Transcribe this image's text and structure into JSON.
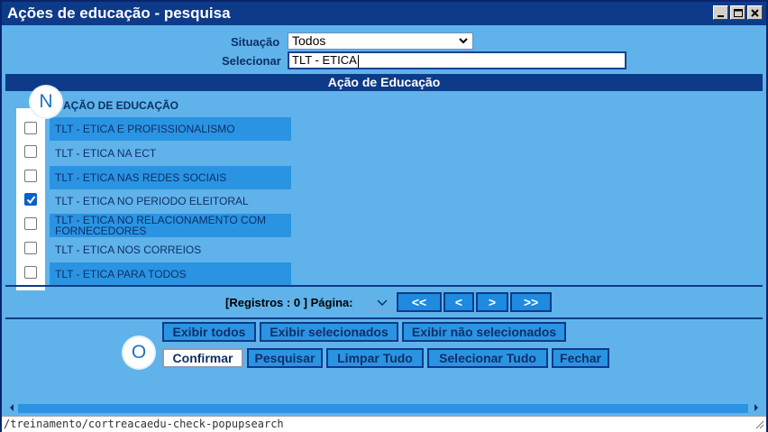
{
  "window": {
    "title": "Ações de educação - pesquisa",
    "controls": [
      "minimize-icon",
      "maximize-icon",
      "close-icon"
    ]
  },
  "filter": {
    "situacao_label": "Situação",
    "situacao_value": "Todos",
    "selecionar_label": "Selecionar",
    "selecionar_value": "TLT - ETICA"
  },
  "section_header": "Ação de Educação",
  "list": {
    "column_header": "AÇÃO DE EDUCAÇÃO",
    "rows": [
      {
        "label": "TLT - ETICA E PROFISSIONALISMO",
        "checked": false
      },
      {
        "label": "TLT - ETICA NA ECT",
        "checked": false
      },
      {
        "label": "TLT - ETICA NAS REDES SOCIAIS",
        "checked": false
      },
      {
        "label": "TLT - ETICA NO PERIODO ELEITORAL",
        "checked": true
      },
      {
        "label": "TLT - ETICA NO RELACIONAMENTO COM FORNECEDORES",
        "checked": false
      },
      {
        "label": "TLT - ETICA NOS CORREIOS",
        "checked": false
      },
      {
        "label": "TLT - ETICA PARA TODOS",
        "checked": false
      }
    ]
  },
  "badges": {
    "n": "N",
    "o": "O"
  },
  "pager": {
    "info": "[Registros : 0 ] Página:",
    "first": "<<",
    "prev": "<",
    "next": ">",
    "last": ">>"
  },
  "actions_row1": {
    "exibir_todos": "Exibir todos",
    "exibir_selecionados": "Exibir selecionados",
    "exibir_nao_selecionados": "Exibir não selecionados"
  },
  "actions_row2": {
    "confirmar": "Confirmar",
    "pesquisar": "Pesquisar",
    "limpar_tudo": "Limpar Tudo",
    "selecionar_tudo": "Selecionar Tudo",
    "fechar": "Fechar"
  },
  "status": {
    "url": "/treinamento/cortreacaedu-check-popupsearch"
  },
  "colors": {
    "title_bar": "#0d3b8a",
    "panel_bg": "#5fb3ea",
    "row_highlight": "#2a94e3",
    "checkbox_checked": "#0a62c9"
  }
}
